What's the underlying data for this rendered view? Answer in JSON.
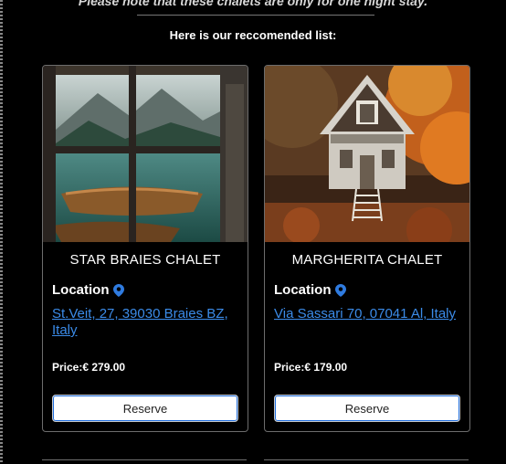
{
  "header": {
    "note": "Please note that these chalets are only for one night stay.",
    "recommended": "Here is our reccomended list:"
  },
  "chalets": [
    {
      "name": "STAR BRAIES CHALET",
      "location_label": "Location",
      "address": "St.Veit, 27, 39030 Braies BZ, Italy",
      "price": "Price:€ 279.00",
      "button": "Reserve"
    },
    {
      "name": "MARGHERITA CHALET",
      "location_label": "Location",
      "address": "Via Sassari 70, 07041 Al, Italy",
      "price": "Price:€ 179.00",
      "button": "Reserve"
    }
  ],
  "colors": {
    "background": "#000000",
    "link": "#3b8be8",
    "pin": "#2f7be0"
  },
  "icons": {
    "location": "map-pin-icon"
  }
}
